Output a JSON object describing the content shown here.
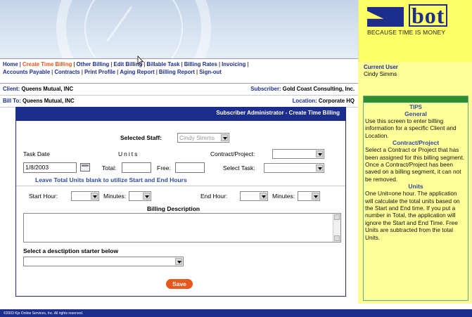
{
  "logo": {
    "text": "bot",
    "tagline": "BECAUSE TIME IS MONEY"
  },
  "nav": {
    "items": [
      {
        "label": "Home",
        "active": false
      },
      {
        "label": "Create Time Billing",
        "active": true
      },
      {
        "label": "Other Billing",
        "active": false
      },
      {
        "label": "Edit Billing",
        "active": false
      },
      {
        "label": "Billable Task",
        "active": false
      },
      {
        "label": "Billing Rates",
        "active": false
      },
      {
        "label": "Invoicing",
        "active": false
      },
      {
        "label": "Accounts Payable",
        "active": false
      },
      {
        "label": "Contracts",
        "active": false
      },
      {
        "label": "Print Profile",
        "active": false
      },
      {
        "label": "Aging Report",
        "active": false
      },
      {
        "label": "Billing Report",
        "active": false
      },
      {
        "label": "Sign-out",
        "active": false
      }
    ]
  },
  "info": {
    "client_label": "Client:",
    "client_value": "Queens Mutual, INC",
    "subscriber_label": "Subscriber:",
    "subscriber_value": "Gold Coast Consulting, Inc.",
    "billto_label": "Bill To:",
    "billto_value": "Queens Mutual, INC",
    "location_label": "Location:",
    "location_value": "Corporate HQ"
  },
  "sidebar": {
    "current_user_label": "Current User",
    "current_user_name": "Cindy Simms",
    "tips_title": "TIPS",
    "sections": [
      {
        "head": "General",
        "body": "Use this screen to enter billing information for a specific Client and Location."
      },
      {
        "head": "Contract/Project",
        "body": "Select a Contract or Project that has been assigned for this billing segment. Once a Contract/Project has been saved on a billing segment, it can not be removed."
      },
      {
        "head": "Units",
        "body": "One Unit=one hour. The application will calculate the total units based on the Start and End time. If you put a number in Total, the application will ignore the Start and End Time. Free Units are subtracted from the total Units."
      }
    ]
  },
  "form": {
    "title": "Subscriber Administrator - Create Time Billing",
    "selected_staff_label": "Selected Staff:",
    "selected_staff_value": "Cindy Simms",
    "task_date_label": "Task Date",
    "task_date_value": "1/8/2003",
    "units_label": "Units",
    "total_label": "Total:",
    "total_value": "",
    "free_label": "Free:",
    "free_value": "",
    "contract_label": "Contract/Project:",
    "contract_value": "",
    "select_task_label": "Select Task:",
    "select_task_value": "",
    "hint": "Leave Total Units blank to utilize Start and End Hours",
    "start_hour_label": "Start Hour:",
    "start_hour_value": "",
    "start_min_label": "Minutes:",
    "start_min_value": "",
    "end_hour_label": "End Hour:",
    "end_hour_value": "",
    "end_min_label": "Minutes:",
    "end_min_value": "",
    "billing_desc_label": "Billing Description",
    "billing_desc_value": "",
    "starter_label": "Select a desctiption starter below",
    "starter_value": "",
    "save_label": "Save"
  },
  "footer": {
    "text": "©2003 Kjo Online Services, Inc. All rights reserved."
  }
}
